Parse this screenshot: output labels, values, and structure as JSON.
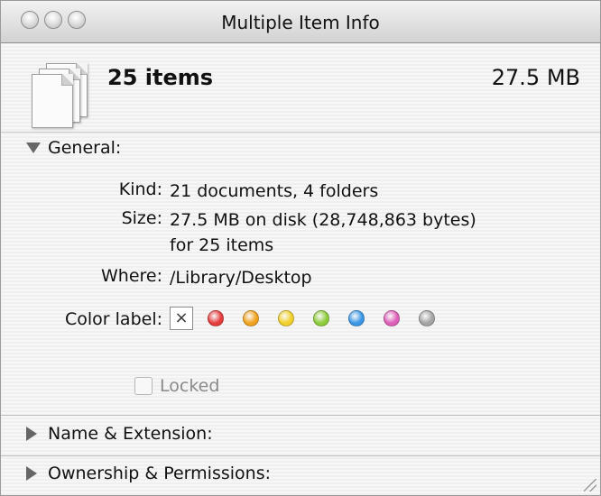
{
  "window": {
    "title": "Multiple Item Info"
  },
  "header": {
    "item_count": "25 items",
    "total_size": "27.5 MB"
  },
  "general": {
    "heading": "General:",
    "kind_label": "Kind:",
    "kind_value": "21 documents, 4 folders",
    "size_label": "Size:",
    "size_value_line1": "27.5 MB on disk (28,748,863 bytes)",
    "size_value_line2": "for 25 items",
    "where_label": "Where:",
    "where_value": "/Library/Desktop",
    "color_label": "Color label:",
    "no_label_glyph": "×",
    "color_labels": [
      "#e53b3b",
      "#f0a21e",
      "#f2d02a",
      "#8ccc3a",
      "#3b97e6",
      "#dd5fb8",
      "#a4a4a4"
    ],
    "locked_label": "Locked"
  },
  "name_extension": {
    "heading": "Name & Extension:"
  },
  "ownership": {
    "heading": "Ownership & Permissions:"
  }
}
